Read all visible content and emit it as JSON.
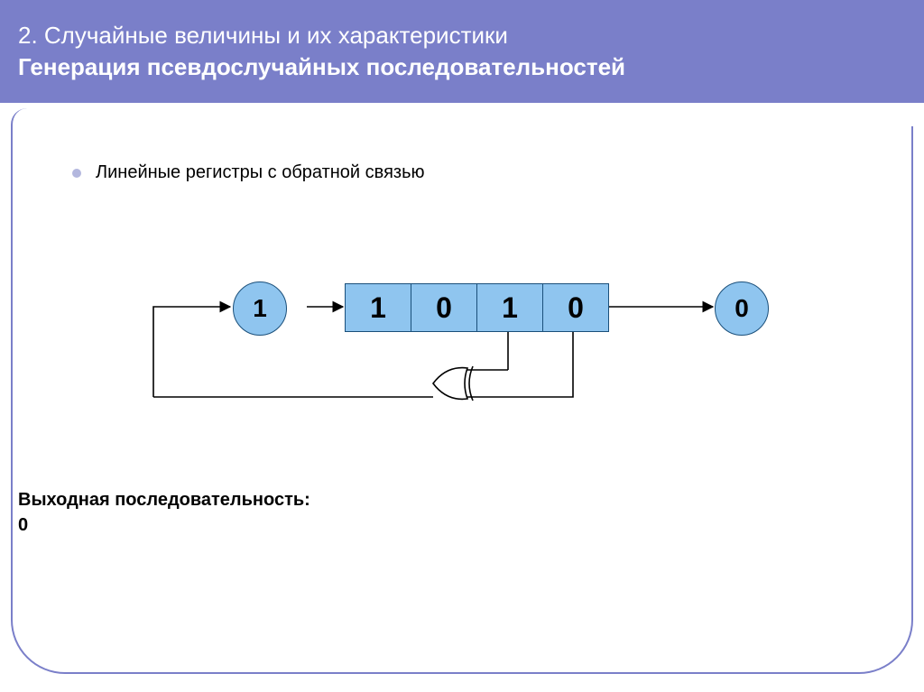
{
  "header": {
    "line1": "2. Случайные величины и их характеристики",
    "line2": "Генерация псевдослучайных последовательностей"
  },
  "bullet": {
    "text": "Линейные регистры с обратной связью"
  },
  "diagram": {
    "feedback_value": "1",
    "register": [
      "1",
      "0",
      "1",
      "0"
    ],
    "output_value": "0"
  },
  "output": {
    "label": "Выходная последовательность:",
    "sequence": "0"
  }
}
